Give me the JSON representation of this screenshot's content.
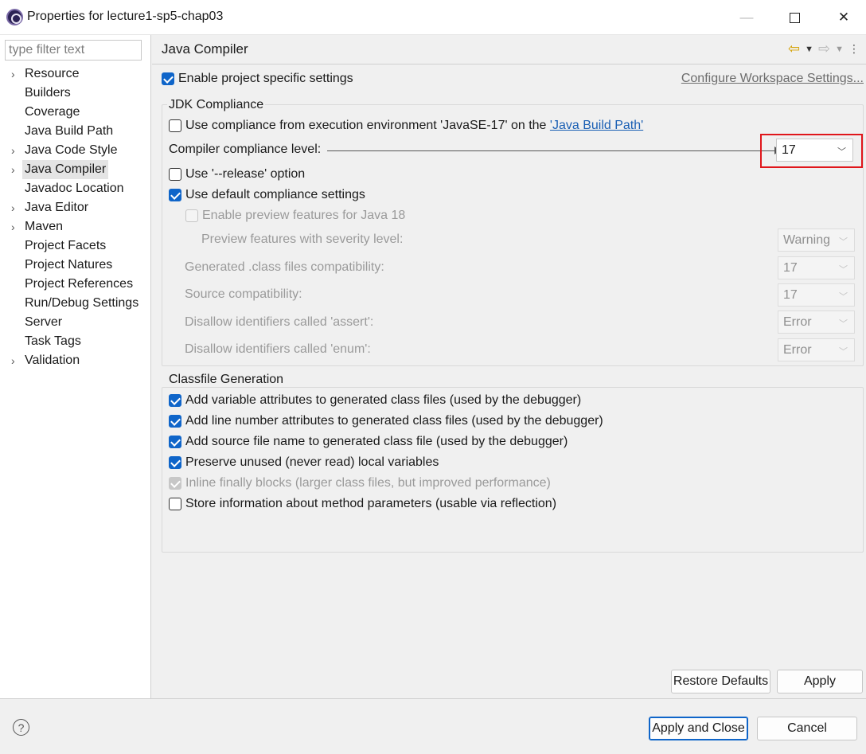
{
  "window": {
    "title": "Properties for lecture1-sp5-chap03",
    "minimize_glyph": "—",
    "close_glyph": "✕"
  },
  "sidebar": {
    "filter_placeholder": "type filter text",
    "items": [
      {
        "label": "Resource",
        "expandable": true
      },
      {
        "label": "Builders",
        "expandable": false
      },
      {
        "label": "Coverage",
        "expandable": false
      },
      {
        "label": "Java Build Path",
        "expandable": false
      },
      {
        "label": "Java Code Style",
        "expandable": true
      },
      {
        "label": "Java Compiler",
        "expandable": true,
        "selected": true
      },
      {
        "label": "Javadoc Location",
        "expandable": false
      },
      {
        "label": "Java Editor",
        "expandable": true
      },
      {
        "label": "Maven",
        "expandable": true
      },
      {
        "label": "Project Facets",
        "expandable": false
      },
      {
        "label": "Project Natures",
        "expandable": false
      },
      {
        "label": "Project References",
        "expandable": false
      },
      {
        "label": "Run/Debug Settings",
        "expandable": false
      },
      {
        "label": "Server",
        "expandable": false
      },
      {
        "label": "Task Tags",
        "expandable": false
      },
      {
        "label": "Validation",
        "expandable": true
      }
    ]
  },
  "page": {
    "title": "Java Compiler",
    "enable_project_specific": "Enable project specific settings",
    "configure_workspace": "Configure Workspace Settings...",
    "jdk_group": {
      "title": "JDK Compliance",
      "use_env_prefix": "Use compliance from execution environment 'JavaSE-17' on the ",
      "use_env_link": "'Java Build Path'",
      "compliance_label": "Compiler compliance level:",
      "compliance_value": "17",
      "release_option": "Use '--release' option",
      "default_settings": "Use default compliance settings",
      "preview_features": "Enable preview features for Java 18",
      "preview_severity_label": "Preview features with severity level:",
      "preview_severity_value": "Warning",
      "generated_label": "Generated .class files compatibility:",
      "generated_value": "17",
      "source_label": "Source compatibility:",
      "source_value": "17",
      "assert_label": "Disallow identifiers called 'assert':",
      "assert_value": "Error",
      "enum_label": "Disallow identifiers called 'enum':",
      "enum_value": "Error"
    },
    "classfile_group": {
      "title": "Classfile Generation",
      "options": [
        {
          "label": "Add variable attributes to generated class files (used by the debugger)",
          "state": "on"
        },
        {
          "label": "Add line number attributes to generated class files (used by the debugger)",
          "state": "on"
        },
        {
          "label": "Add source file name to generated class file (used by the debugger)",
          "state": "on"
        },
        {
          "label": "Preserve unused (never read) local variables",
          "state": "on"
        },
        {
          "label": "Inline finally blocks (larger class files, but improved performance)",
          "state": "disabled-on"
        },
        {
          "label": "Store information about method parameters (usable via reflection)",
          "state": "off"
        }
      ]
    },
    "restore_defaults": "Restore Defaults",
    "apply": "Apply"
  },
  "footer": {
    "help_glyph": "?",
    "apply_and_close": "Apply and Close",
    "cancel": "Cancel"
  },
  "colors": {
    "checkbox_checked": "#0f65c9",
    "link": "#1a5fb4",
    "highlight": "#e0161b"
  }
}
